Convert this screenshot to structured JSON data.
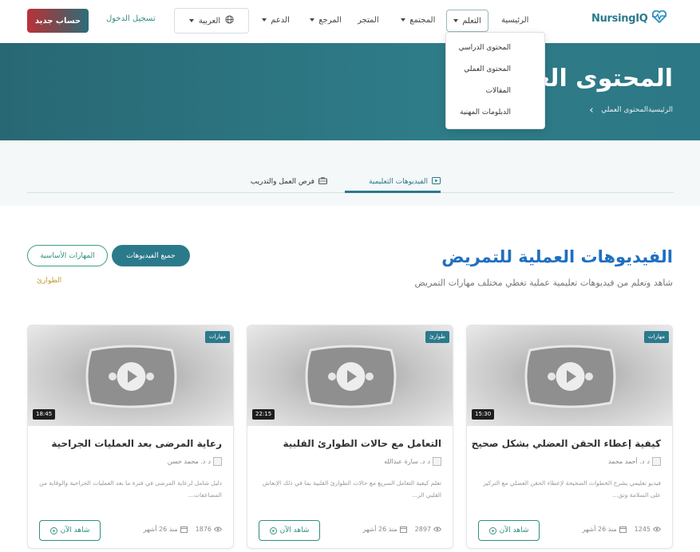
{
  "header": {
    "logo_text": "NursingIQ",
    "nav": [
      {
        "label": "الرئيسية",
        "has_caret": false
      },
      {
        "label": "التعلم",
        "has_caret": true,
        "active": true
      },
      {
        "label": "المجتمع",
        "has_caret": true
      },
      {
        "label": "المتجر",
        "has_caret": false
      },
      {
        "label": "المرجع",
        "has_caret": true
      },
      {
        "label": "الدعم",
        "has_caret": true
      }
    ],
    "language_label": "العربية",
    "login_label": "تسجيل الدخول",
    "signup_label": "حساب جديد"
  },
  "dropdown": {
    "items": [
      "المحتوى الدراسي",
      "المحتوى العملي",
      "المقالات",
      "الدبلومات المهنية"
    ]
  },
  "hero": {
    "title": "المحتوى العملي",
    "breadcrumb_home": "الرئيسية",
    "breadcrumb_current": "المحتوى العملي"
  },
  "tabs": [
    {
      "label": "الفيديوهات التعليمية",
      "active": true,
      "icon": "play-icon"
    },
    {
      "label": "فرص العمل والتدريب",
      "active": false,
      "icon": "briefcase-icon"
    }
  ],
  "section": {
    "title": "الفيديوهات العملية للتمريض",
    "subtitle": "شاهد وتعلم من فيديوهات تعليمية عملية تغطي مختلف مهارات التمريض",
    "filters": [
      "جميع الفيديوهات",
      "المهارات الأساسية",
      "الطوارئ"
    ]
  },
  "cards": [
    {
      "badge": "مهارات",
      "duration": "15:30",
      "title": "كيفية إعطاء الحقن العضلي بشكل صحيح",
      "author_alt": "د",
      "author": "د. أحمد محمد",
      "description": "فيديو تعليمي يشرح الخطوات الصحيحة لإعطاء الحقن العضلي مع التركيز على السلامة وتق...",
      "views": "1245",
      "date": "منذ 26 أشهر",
      "watch_label": "شاهد الآن"
    },
    {
      "badge": "طوارئ",
      "duration": "22:15",
      "title": "التعامل مع حالات الطوارئ القلبية",
      "author_alt": "د",
      "author": "د. سارة عبدالله",
      "description": "تعلم كيفية التعامل السريع مع حالات الطوارئ القلبية بما في ذلك الإنعاش القلبي الر...",
      "views": "2897",
      "date": "منذ 26 أشهر",
      "watch_label": "شاهد الآن"
    },
    {
      "badge": "مهارات",
      "duration": "18:45",
      "title": "رعاية المرضى بعد العمليات الجراحية",
      "author_alt": "د",
      "author": "د. محمد حسن",
      "description": "دليل شامل لرعاية المرضى في فترة ما بعد العمليات الجراحية والوقاية من المضاعفات...",
      "views": "1876",
      "date": "منذ 26 أشهر",
      "watch_label": "شاهد الآن"
    }
  ],
  "colors": {
    "primary": "#2b7a8c",
    "title_blue": "#1f6fc0",
    "accent_green": "#2f8f80",
    "emergency_gold": "#c09a2b",
    "signup_gradient_start": "#b8323a"
  }
}
